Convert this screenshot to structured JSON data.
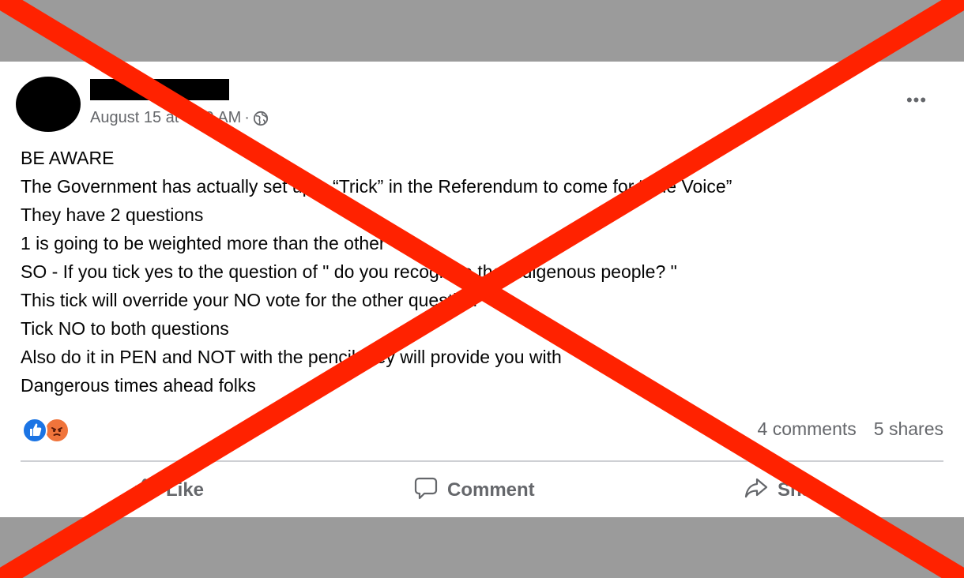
{
  "post": {
    "timestamp": "August 15 at 7:59 AM",
    "separator": "·",
    "privacy_icon": "globe-icon",
    "more_label": "•••",
    "lines": [
      "BE AWARE",
      "The Government has actually set up a “Trick” in the Referendum to come for “The Voice”",
      "They have 2 questions",
      "1 is going to be weighted more than the other",
      "SO  - If you tick yes to the question of \" do you recognise the indigenous people? \"",
      "This tick will override your NO vote for the other question",
      "Tick NO to both questions",
      "Also do it in PEN and NOT with the pencil they will provide you with",
      "Dangerous times ahead folks"
    ],
    "reactions": [
      "like-reaction-icon",
      "angry-reaction-icon"
    ],
    "comments": "4 comments",
    "shares": "5 shares",
    "actions": {
      "like": "Like",
      "comment": "Comment",
      "share": "Share"
    }
  },
  "overlay": {
    "cross_color": "#ff2200",
    "meaning": "false-claim-cross-icon"
  },
  "colors": {
    "frame": "#9b9b9b",
    "card": "#ffffff",
    "text": "#050505",
    "muted": "#65676b",
    "like_blue": "#1b74e4",
    "angry_orange": "#f0743b"
  }
}
